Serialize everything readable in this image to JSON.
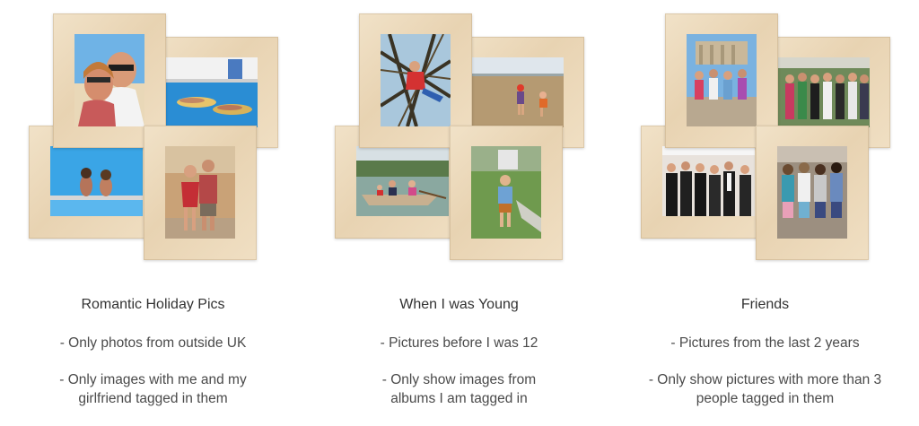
{
  "columns": [
    {
      "title": "Romantic Holiday Pics",
      "rules": [
        [
          "- Only photos from outside UK"
        ],
        [
          "- Only images with me and my",
          "girlfriend tagged in them"
        ]
      ],
      "photos": [
        "couple-selfie-beach",
        "pool-floating",
        "pool-sitting",
        "couple-standing"
      ]
    },
    {
      "title": "When I was Young",
      "rules": [
        [
          "- Pictures before I was 12"
        ],
        [
          "- Only show images from",
          "albums I am tagged in"
        ]
      ],
      "photos": [
        "child-in-tree",
        "children-on-beach",
        "rowing-boat",
        "boy-on-lawn"
      ]
    },
    {
      "title": "Friends",
      "rules": [
        [
          "- Pictures from the last 2 years"
        ],
        [
          "- Only show pictures with more than 3",
          "people tagged in them"
        ]
      ],
      "photos": [
        "group-at-ruins",
        "group-on-terrace",
        "group-black-tie",
        "group-from-behind"
      ]
    }
  ],
  "colors": {
    "wood": "#ecdabd",
    "text": "#333333"
  }
}
